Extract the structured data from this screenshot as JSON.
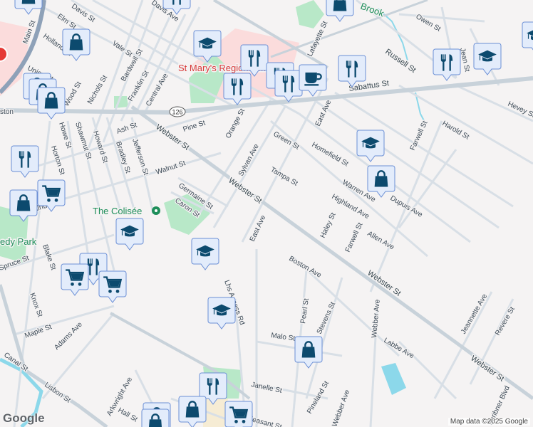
{
  "map": {
    "attribution": "Map data ©2025 Google",
    "logo": "Google",
    "route_shield": "126",
    "colors": {
      "background": "#f5f3f3",
      "road": "#d3dbe2",
      "major_road": "#c8d2da",
      "park": "#b8e8c8",
      "medical": "#fbdcdc",
      "water": "#8cd8ea",
      "marker_fill": "#e3ecfb",
      "marker_icon": "#0c4a6e"
    },
    "pois": [
      {
        "name": "St Mary's Regional Medical"
      },
      {
        "name": "The Colisée"
      },
      {
        "name": "edy Park"
      }
    ],
    "streets": [
      "Elm St",
      "Davis St",
      "Holland St",
      "Main St",
      "Vale St",
      "Nichols St",
      "Bardwell St",
      "Franklin St",
      "Central Ave",
      "Wood St",
      "Union St",
      "ston",
      "Pine St",
      "Ash St",
      "Jefferson St",
      "Bradley St",
      "Howard St",
      "Shawmut St",
      "Howe St",
      "Horton St",
      "Walnut St",
      "Walnut St",
      "Webster St",
      "Webster St",
      "Webster St",
      "Webster St",
      "Orange St",
      "Sylvan Ave",
      "Germaine St",
      "Caron St",
      "Lafayette St",
      "Sabattus St",
      "Russell St",
      "Owen St",
      "Jean St",
      "East Ave",
      "Green St",
      "Homefield St",
      "Tampa St",
      "Warren Ave",
      "Highland Ave",
      "Dupuis Ave",
      "Farwell St",
      "Harold St",
      "Hevey St",
      "Haley St",
      "Farwell St",
      "Allen Ave",
      "East Ave",
      "Boston Ave",
      "Pearl St",
      "Stevens St",
      "Malo St",
      "Webber Ave",
      "Labbe Ave",
      "Jeannette Ave",
      "Revere St",
      "Scribner Blvd",
      "Pineland St",
      "Janelle St",
      "Lhs Access Rd",
      "Maple St",
      "Adams Ave",
      "Knox St",
      "Blake St",
      "Spruce St",
      "Canal St",
      "Lisbon St",
      "Arkwright Ave",
      "Hall St",
      "Webber Ave",
      "Davis Ave",
      "Pleasant St",
      "Brook"
    ],
    "markers": [
      "shopping-bag",
      "school",
      "restaurant",
      "restaurant",
      "restaurant",
      "restaurant",
      "cafe",
      "restaurant",
      "restaurant",
      "school",
      "shopping-bag",
      "shopping-bag",
      "shopping-bag",
      "shopping-bag",
      "restaurant",
      "shopping-bag",
      "grocery-cart",
      "school",
      "school",
      "restaurant",
      "grocery-cart",
      "grocery-cart",
      "school",
      "school",
      "shopping-bag",
      "shopping-bag",
      "restaurant",
      "shopping-bag",
      "shopping-bag",
      "shopping-bag",
      "grocery-cart",
      "shopping-bag",
      "restaurant",
      "school"
    ]
  }
}
